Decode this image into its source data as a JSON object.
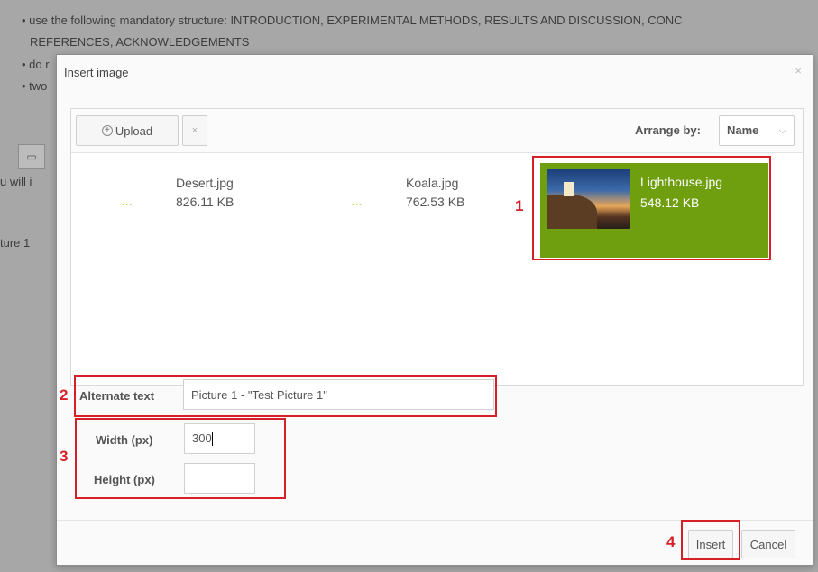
{
  "background": {
    "line1": "• use the following mandatory structure: INTRODUCTION, EXPERIMENTAL METHODS, RESULTS AND DISCUSSION, CONC",
    "line2": "REFERENCES, ACKNOWLEDGEMENTS",
    "line3": "• do r",
    "line4": "• two",
    "side_text_1": "u will i",
    "side_text_2": "ture 1"
  },
  "dialog": {
    "title": "Insert image",
    "close_glyph": "×"
  },
  "toolbar": {
    "upload_label": "Upload",
    "upload_icon_glyph": "+",
    "remove_glyph": "×",
    "arrange_label": "Arrange by:",
    "arrange_value": "Name",
    "arrange_chevron": "⌵"
  },
  "files": [
    {
      "name": "Desert.jpg",
      "size": "826.11 KB",
      "thumb": "···",
      "selected": false
    },
    {
      "name": "Koala.jpg",
      "size": "762.53 KB",
      "thumb": "···",
      "selected": false
    },
    {
      "name": "Lighthouse.jpg",
      "size": "548.12 KB",
      "selected": true
    }
  ],
  "form": {
    "alt_label": "Alternate text",
    "alt_value": "Picture 1 - \"Test Picture 1\"",
    "width_label": "Width (px)",
    "width_value": "300",
    "height_label": "Height (px)",
    "height_value": ""
  },
  "footer": {
    "insert_label": "Insert",
    "cancel_label": "Cancel"
  },
  "annotations": {
    "color": "#d62027",
    "numbers": [
      "1",
      "2",
      "3",
      "4"
    ]
  },
  "colors": {
    "selected_file_bg": "#6f9e0f"
  }
}
